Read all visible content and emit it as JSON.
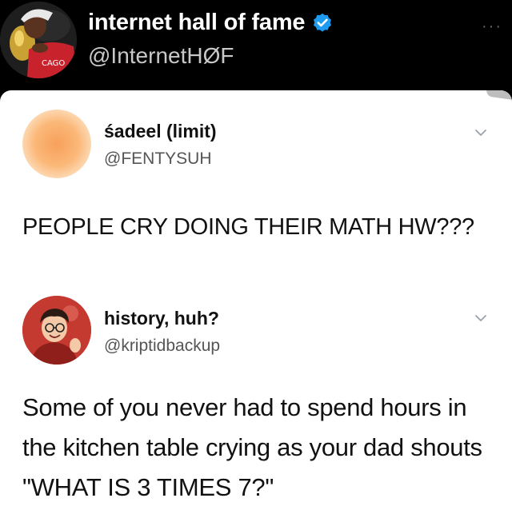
{
  "outer_tweet": {
    "name": "internet hall of fame",
    "handle": "@InternetHØF",
    "verified": true,
    "avatar_icon": "basketball-player-avatar",
    "more_icon": "···"
  },
  "embedded_tweets": [
    {
      "name": "śadeel (limit)",
      "handle": "@FENTYSUH",
      "avatar_icon": "orange-gradient-avatar",
      "text": "PEOPLE CRY DOING THEIR MATH HW???"
    },
    {
      "name": "history, huh?",
      "handle": "@kriptidbackup",
      "avatar_icon": "cartoon-person-avatar",
      "text": "Some of you never had to spend hours in the kitchen table crying as your dad shouts \"WHAT IS 3 TIMES 7?\""
    }
  ],
  "colors": {
    "background": "#000000",
    "card": "#ffffff",
    "verified_blue": "#1d9bf0"
  }
}
